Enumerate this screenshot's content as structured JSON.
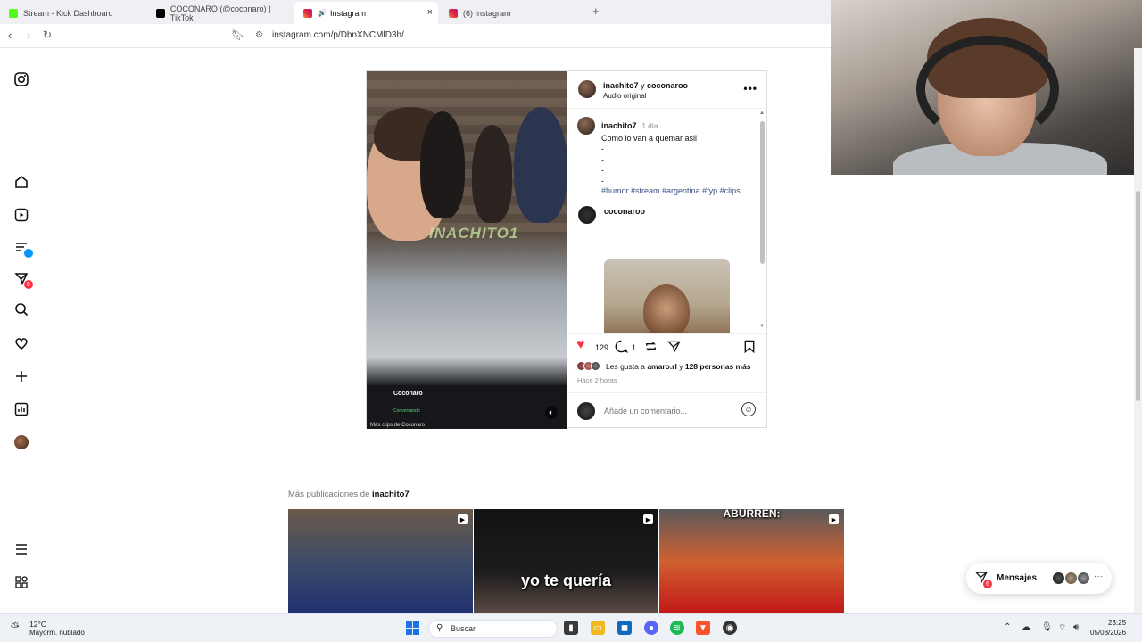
{
  "browser": {
    "tabs": [
      {
        "label": "Stream - Kick Dashboard",
        "color": "#53fc18"
      },
      {
        "label": "COCONARO (@coconaro) | TikTok",
        "color": "#000000"
      },
      {
        "label": "Instagram",
        "color": "#e1306c"
      },
      {
        "label": "(6) Instagram",
        "color": "#e1306c"
      }
    ],
    "new_tab": "+",
    "close": "×",
    "url": "instagram.com/p/DbnXNCMlD3h/"
  },
  "nav": {
    "items": [
      "instagram-logo",
      "home",
      "reels",
      "feed",
      "messages",
      "search",
      "notifications",
      "create",
      "dashboard",
      "profile"
    ],
    "feed_badge": "",
    "messages_badge": "6",
    "more": "menu",
    "meta": "apps"
  },
  "post": {
    "author": "inachito7",
    "and": " y ",
    "coauthor": "coconaroo",
    "audio": "Audio original",
    "more": "•••",
    "watermark": "INACHITO1",
    "stream_name": "Coconaro",
    "stream_status": "Conversando",
    "stream_more": "Más clips de Coconaro",
    "caption": {
      "user": "inachito7",
      "time": "1 día",
      "text": "Como lo van a quemar asii",
      "dashes": [
        "-",
        "-",
        "-",
        "-"
      ],
      "hashtags": "#humor #stream #argentina #fyp #clips"
    },
    "reply": {
      "user": "coconaroo"
    },
    "likes_count": "129",
    "comments_count": "1",
    "liked_by_prefix": "Les gusta a ",
    "liked_by_user": "amaro.rl",
    "liked_by_mid": " y ",
    "liked_by_rest": "128 personas más",
    "timestamp": "Hace 2 horas",
    "add_comment_placeholder": "Añade un comentario..."
  },
  "more_posts": {
    "prefix": "Más publicaciones de ",
    "user": "inachito7",
    "thumbs": [
      {
        "caption": ""
      },
      {
        "caption": "yo te quería"
      },
      {
        "caption": "ABURREN:"
      }
    ]
  },
  "messages": {
    "label": "Mensajes",
    "badge": "6",
    "more": "···"
  },
  "taskbar": {
    "temp": "12°C",
    "weather": "Mayorm. nublado",
    "search": "Buscar",
    "time": "23:25",
    "date": "05/08/2026"
  }
}
